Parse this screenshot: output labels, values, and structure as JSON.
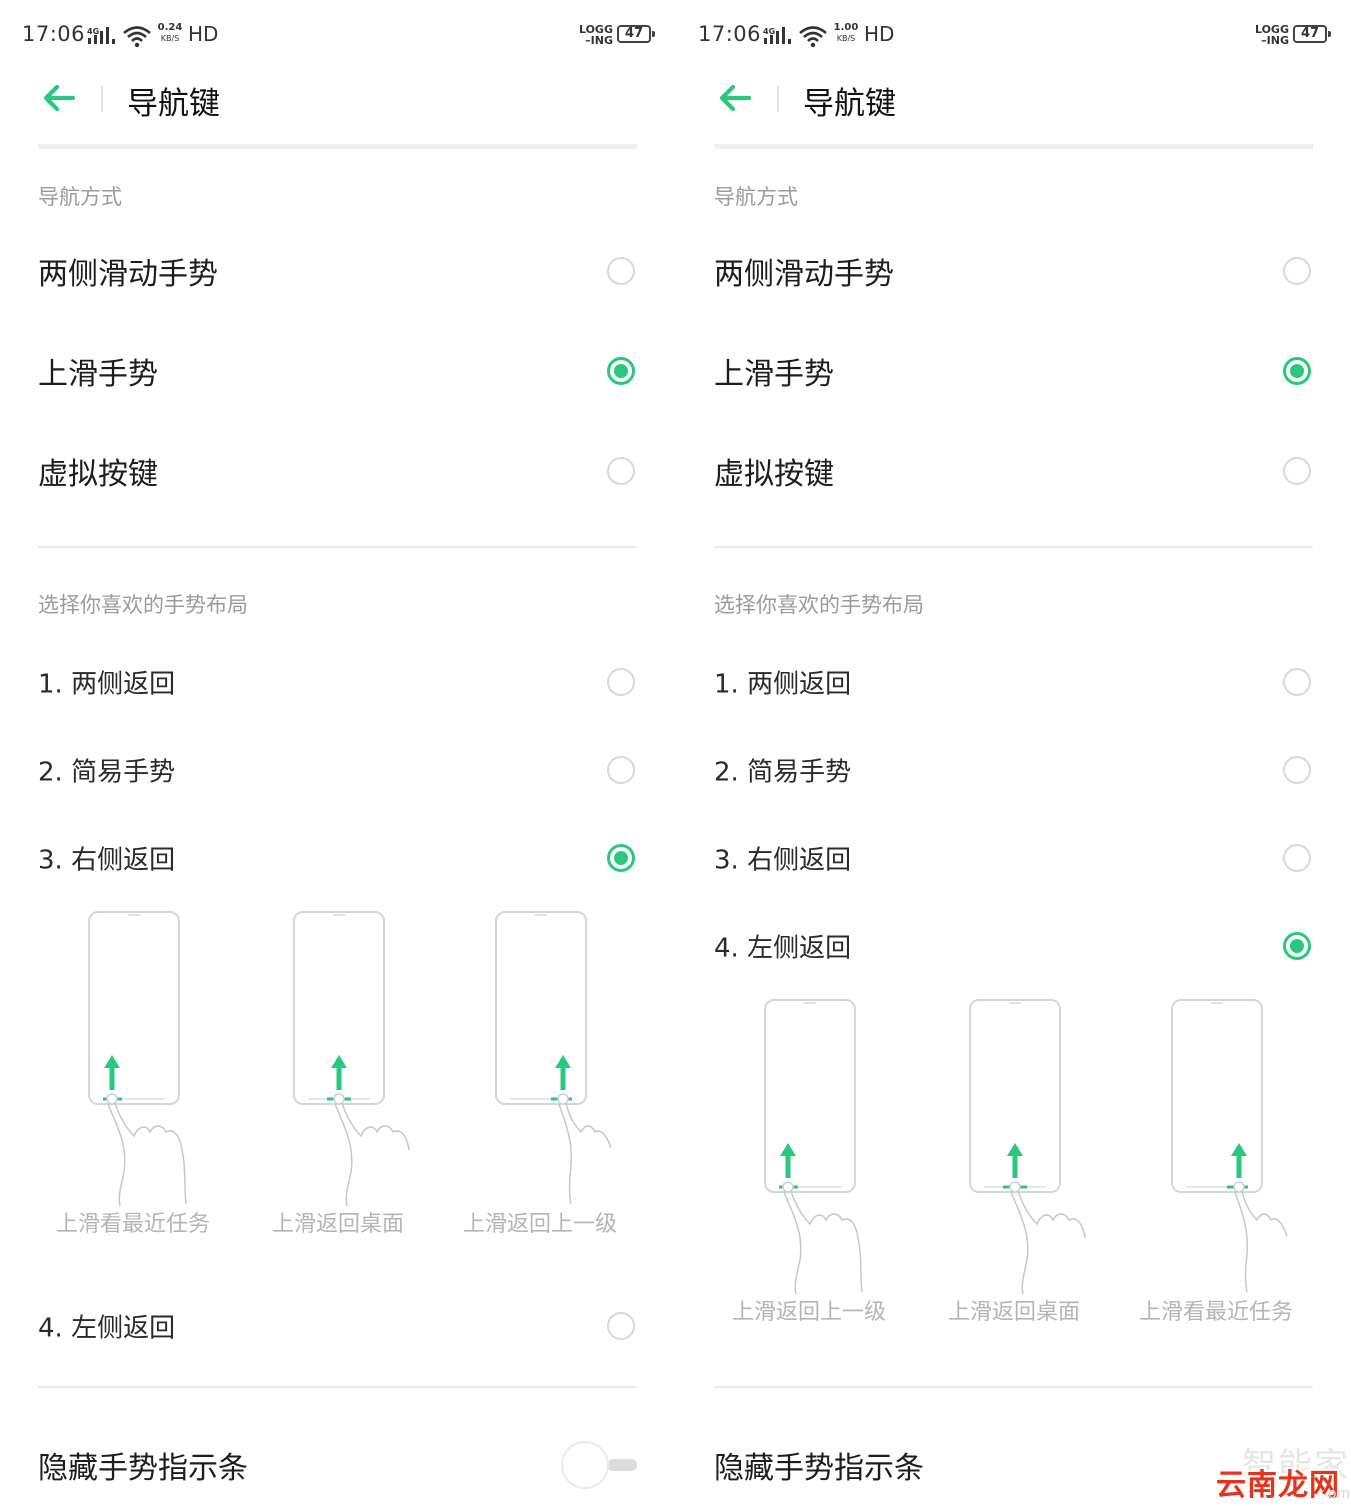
{
  "status_bar": {
    "time": "17:06",
    "network": "4G",
    "left_speed": "0.24",
    "right_speed": "1.00",
    "speed_unit": "KB/S",
    "hd": "HD",
    "logg_line1": "LOGG",
    "logg_line2": "–ING",
    "battery": "47"
  },
  "header": {
    "title": "导航键",
    "back_icon": "arrow-left-icon"
  },
  "nav_section": {
    "header": "导航方式",
    "options": [
      "两侧滑动手势",
      "上滑手势",
      "虚拟按键"
    ],
    "selected": "上滑手势"
  },
  "layout_section": {
    "header": "选择你喜欢的手势布局",
    "options": [
      "1. 两侧返回",
      "2. 简易手势",
      "3. 右侧返回",
      "4. 左侧返回"
    ]
  },
  "left_panel": {
    "selected_layout": "3. 右侧返回",
    "captions": [
      "上滑看最近任务",
      "上滑返回桌面",
      "上滑返回上一级"
    ]
  },
  "right_panel": {
    "selected_layout": "4. 左侧返回",
    "captions": [
      "上滑返回上一级",
      "上滑返回桌面",
      "上滑看最近任务"
    ]
  },
  "hide_bar": {
    "label": "隐藏手势指示条",
    "enabled": false
  },
  "watermark": {
    "line1": "智能家",
    "line2": "云南龙网",
    "line3": "om"
  },
  "colors": {
    "accent": "#2ac87d",
    "section_text": "#9b9b9b",
    "caption_text": "#b5b5b5"
  }
}
